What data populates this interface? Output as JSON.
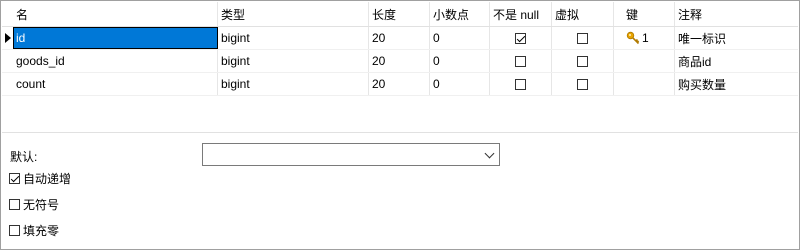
{
  "columns": {
    "name": "名",
    "type": "类型",
    "length": "长度",
    "decimals": "小数点",
    "not_null": "不是 null",
    "virtual": "虚拟",
    "key": "键",
    "comment": "注释"
  },
  "rows": [
    {
      "name": "id",
      "type": "bigint",
      "length": "20",
      "decimals": "0",
      "not_null": true,
      "virtual": false,
      "key": "1",
      "comment": "唯一标识"
    },
    {
      "name": "goods_id",
      "type": "bigint",
      "length": "20",
      "decimals": "0",
      "not_null": false,
      "virtual": false,
      "key": "",
      "comment": "商品id"
    },
    {
      "name": "count",
      "type": "bigint",
      "length": "20",
      "decimals": "0",
      "not_null": false,
      "virtual": false,
      "key": "",
      "comment": "购买数量"
    }
  ],
  "properties": {
    "default_label": "默认:",
    "default_value": "",
    "auto_increment_label": "自动递增",
    "auto_increment_checked": true,
    "unsigned_label": "无符号",
    "unsigned_checked": false,
    "zerofill_label": "填充零",
    "zerofill_checked": false
  },
  "colors": {
    "selection": "#0078d7",
    "key_icon": "#e8a400"
  }
}
